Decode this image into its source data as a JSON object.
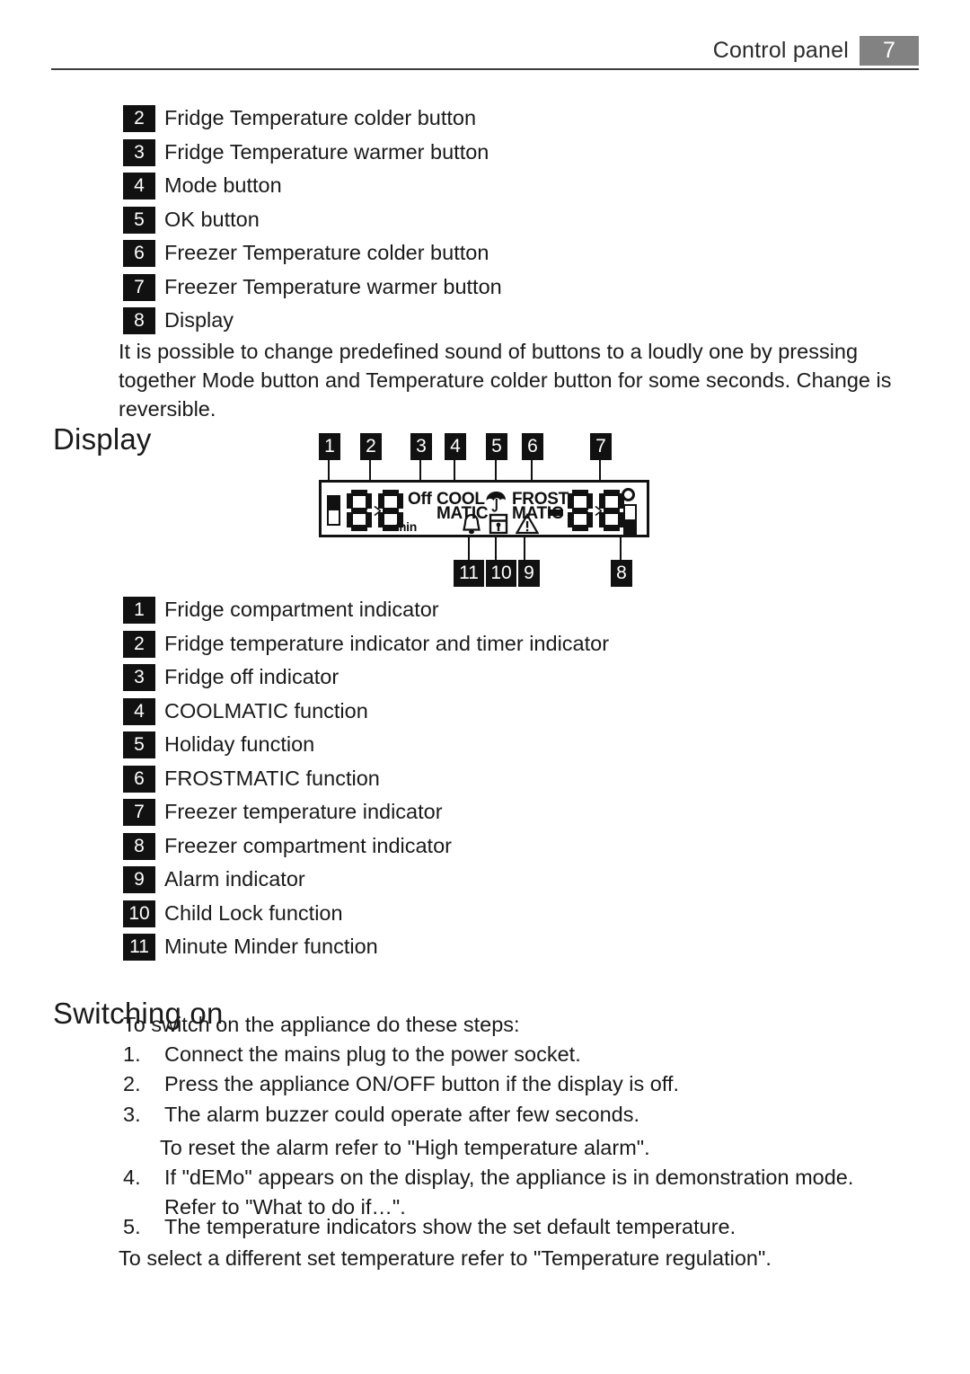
{
  "header": {
    "title": "Control panel",
    "page_number": "7"
  },
  "control_panel_legend": [
    {
      "num": "2",
      "label": "Fridge Temperature colder button"
    },
    {
      "num": "3",
      "label": "Fridge Temperature warmer button"
    },
    {
      "num": "4",
      "label": "Mode button"
    },
    {
      "num": "5",
      "label": "OK button"
    },
    {
      "num": "6",
      "label": "Freezer Temperature colder button"
    },
    {
      "num": "7",
      "label": "Freezer Temperature warmer button"
    },
    {
      "num": "8",
      "label": "Display"
    }
  ],
  "sound_note": "It is possible to change predefined sound of buttons to a loudly one by pressing together Mode button and Temperature colder button for some seconds. Change is reversible.",
  "display_section": {
    "heading": "Display",
    "figure": {
      "callouts_top": [
        "1",
        "2",
        "3",
        "4",
        "5",
        "6",
        "7"
      ],
      "callouts_bottom": [
        "11",
        "10",
        "9",
        "8"
      ],
      "lcd_text": {
        "off": "Off",
        "cool": "COOL",
        "cool_matic": "MATIC",
        "min": "min",
        "frost": "FROST",
        "frost_matic": "MATIC",
        "fridge_digits": "88",
        "freezer_digits": "88",
        "freezer_minus": "-"
      },
      "icons": {
        "fridge_compartment": "fridge-compartment-indicator-icon",
        "freezer_compartment": "freezer-compartment-indicator-icon",
        "holiday": "umbrella-holiday-icon",
        "minute_minder": "bell-icon",
        "child_lock": "child-lock-icon",
        "alarm": "warning-triangle-icon",
        "degree": "degree-circle-icon"
      }
    },
    "legend": [
      {
        "num": "1",
        "label": "Fridge compartment indicator"
      },
      {
        "num": "2",
        "label": "Fridge temperature indicator and timer indicator"
      },
      {
        "num": "3",
        "label": "Fridge off indicator"
      },
      {
        "num": "4",
        "label": "COOLMATIC function"
      },
      {
        "num": "5",
        "label": "Holiday function"
      },
      {
        "num": "6",
        "label": "FROSTMATIC function"
      },
      {
        "num": "7",
        "label": "Freezer temperature indicator"
      },
      {
        "num": "8",
        "label": "Freezer compartment indicator"
      },
      {
        "num": "9",
        "label": "Alarm indicator"
      },
      {
        "num": "10",
        "label": "Child Lock function"
      },
      {
        "num": "11",
        "label": "Minute Minder function"
      }
    ]
  },
  "switching_on": {
    "heading": "Switching on",
    "intro": "To switch on the appliance do these steps:",
    "steps": [
      {
        "num": "1.",
        "text": "Connect the mains plug to the power socket."
      },
      {
        "num": "2.",
        "text": "Press the appliance ON/OFF button if the display is off."
      },
      {
        "num": "3.",
        "text": "The alarm buzzer could operate after few seconds."
      },
      {
        "num": "",
        "text": "To reset the alarm refer to \"High temperature alarm\"."
      },
      {
        "num": "4.",
        "text": "If \"dEMo\" appears on the display, the appliance is in demonstration mode. Refer to \"What to do if…\"."
      },
      {
        "num": "5.",
        "text": "The temperature indicators show the set default temperature."
      }
    ],
    "closing": "To select a different set temperature refer to \"Temperature regulation\"."
  }
}
